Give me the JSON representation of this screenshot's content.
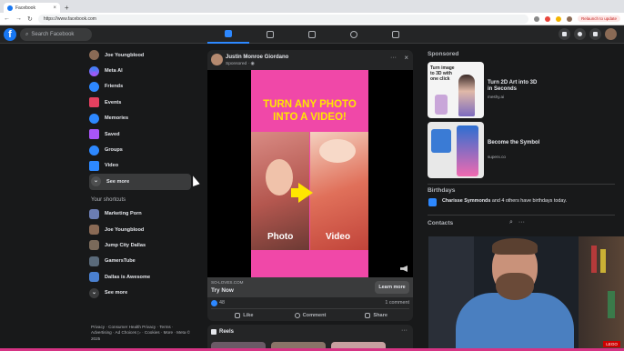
{
  "browser": {
    "tab_title": "Facebook",
    "url": "https://www.facebook.com",
    "relaunch_label": "Relaunch to update"
  },
  "topbar": {
    "logo_letter": "f",
    "search_placeholder": "Search Facebook"
  },
  "leftnav": {
    "items": [
      {
        "label": "Joe Youngblood",
        "icon": "avatar",
        "color": "#8a6a55"
      },
      {
        "label": "Meta AI",
        "icon": "meta-ai-icon",
        "color": "#3b82f6"
      },
      {
        "label": "Friends",
        "icon": "friends-icon",
        "color": "#2d88ff"
      },
      {
        "label": "Events",
        "icon": "events-icon",
        "color": "#e4405f"
      },
      {
        "label": "Memories",
        "icon": "memories-icon",
        "color": "#2d88ff"
      },
      {
        "label": "Saved",
        "icon": "saved-icon",
        "color": "#a855f7"
      },
      {
        "label": "Groups",
        "icon": "groups-icon",
        "color": "#2d88ff"
      },
      {
        "label": "Video",
        "icon": "video-icon",
        "color": "#2d88ff"
      }
    ],
    "see_more_1": "See more",
    "shortcuts_header": "Your shortcuts",
    "shortcuts": [
      {
        "label": "Marketing Porn",
        "color": "#6b7db3"
      },
      {
        "label": "Joe Youngblood",
        "color": "#8a6a55"
      },
      {
        "label": "Jump City Dallas",
        "color": "#7a6a5a"
      },
      {
        "label": "GamersTube",
        "color": "#5a6a7a"
      },
      {
        "label": "Dallas is Awesome",
        "color": "#4a80d0"
      }
    ],
    "see_more_2": "See more",
    "footer": "Privacy · Consumer Health Privacy · Terms · Advertising · Ad Choices ▷ · Cookies · More · Meta © 2025"
  },
  "post": {
    "author": "Justin Monroe Giordano",
    "sub": "Sponsored · ◉",
    "ad_title": "TURN ANY PHOTO INTO A VIDEO!",
    "label_left": "Photo",
    "label_right": "Video",
    "cta_domain": "SO-LOVES.COM",
    "cta_text": "Try Now",
    "cta_button": "Learn more",
    "likes": "48",
    "comments": "1 comment",
    "action_like": "Like",
    "action_comment": "Comment",
    "action_share": "Share"
  },
  "reels": {
    "title": "Reels"
  },
  "rightrail": {
    "sponsored_header": "Sponsored",
    "sponsor1_img_text": "Turn image to 3D with one click",
    "sponsor1_title": "Turn 2D Art into 3D in Seconds",
    "sponsor1_domain": "meshy.ai",
    "sponsor2_title": "Become the Symbol",
    "sponsor2_domain": "superx.co",
    "birthdays_header": "Birthdays",
    "birthday_name": "Charisse Symmonds",
    "birthday_text": " and 4 others have birthdays today.",
    "contacts_header": "Contacts",
    "webcam_badge": "LEGO"
  }
}
